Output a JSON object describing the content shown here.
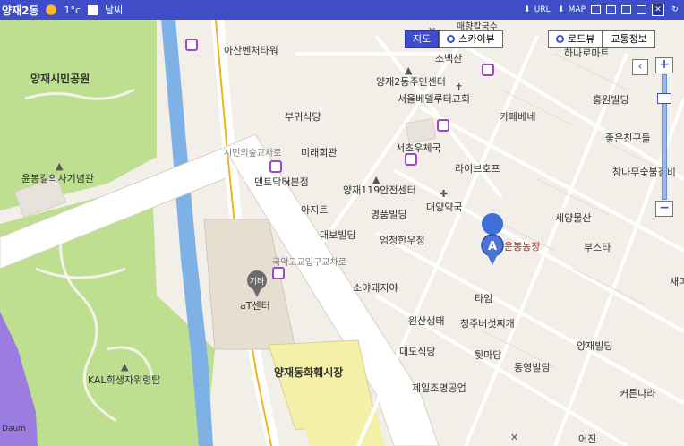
{
  "topbar": {
    "location": "양재2동",
    "temperature": "1°c",
    "weather_label": "날씨",
    "url_label": "URL",
    "map_label": "MAP"
  },
  "map_controls": {
    "map_tab": "지도",
    "skyview_tab": "스카이뷰",
    "roadview_button": "로드뷰",
    "traffic_button": "교통정보"
  },
  "marker": {
    "letter": "A",
    "label": "운봉농장"
  },
  "category_pin": "기타",
  "labels": {
    "park": "양재시민공원",
    "memorial": "윤봉길의사기념관",
    "tower": "KAL희생자위령탑",
    "at_center": "aT센터",
    "market": "양재동화훼시장",
    "asan": "아산벤처타워",
    "bugwi": "부귀식당",
    "mirae": "미래회관",
    "dental": "덴트닥터본점",
    "ajit": "아지트",
    "daebo": "대보빌딩",
    "civic_forest": "시민의숲교차로",
    "gukak": "국악고교입구교차로",
    "soya": "소야돼지야",
    "wonsan": "원산생태",
    "daedo": "대도식당",
    "jeil": "제일조명공업",
    "cheongju": "청주버섯찌개",
    "tim": "타임",
    "twis": "튓마당",
    "dongyeong": "동영빌딩",
    "yangjae_bldg": "양재빌딩",
    "curtain": "커튼나라",
    "busta": "부스타",
    "seyang": "세양물산",
    "chamnamu": "참나무숯불갈비",
    "joeun": "좋은친구들",
    "hongwon": "홍원빌딩",
    "cafe": "카페베네",
    "life_house": "라이브호프",
    "seocho_post": "서초우체국",
    "yangjae119": "양재119안전센터",
    "myeongpum": "명품빌딩",
    "daeyang": "대양약국",
    "eomcheong": "엄청한우정",
    "sobaeksan": "소백산",
    "community": "양재2동주민센터",
    "church": "서울베델루터교회",
    "hana": "하나로마트",
    "maehyang": "매향칼국수",
    "ssam": "새마",
    "eojin": "어진"
  },
  "footer": {
    "logo": "Daum"
  }
}
